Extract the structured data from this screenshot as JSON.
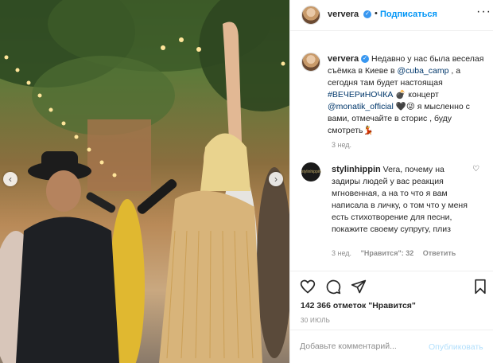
{
  "post": {
    "username": "ververa",
    "follow_label": "Подписаться",
    "separator": "•",
    "more_label": "···"
  },
  "caption": {
    "username": "ververa",
    "text_1": " Недавно у нас была веселая съёмка в Киеве в ",
    "mention_1": "@cuba_camp",
    "text_2": " , а сегодня там будет настоящая ",
    "hashtag": "#ВЕЧЕРиНОЧКА",
    "text_3": " 💣 концерт ",
    "mention_2": "@monatik_official",
    "text_4": " 🖤😜 я мысленно с вами, отмечайте в сторис , буду смотреть💃",
    "time": "3 нед."
  },
  "reply": {
    "username": "stylinhippin",
    "avatar_text": "stylinhippin",
    "text": " Vera, почему на задиры людей у вас реакция мгновенная, а на то что я вам написала в личку, о том что у меня есть стихотворение для песни, покажите своему супругу, плиз",
    "time": "3 нед.",
    "likes": "\"Нравится\": 32",
    "reply_label": "Ответить"
  },
  "actions": {
    "likes_text": "142 366 отметок \"Нравится\"",
    "date": "30 ИЮЛЬ"
  },
  "comment_box": {
    "placeholder": "Добавьте комментарий...",
    "publish_label": "Опубликовать"
  },
  "carousel": {
    "prev_icon": "‹",
    "next_icon": "›"
  }
}
